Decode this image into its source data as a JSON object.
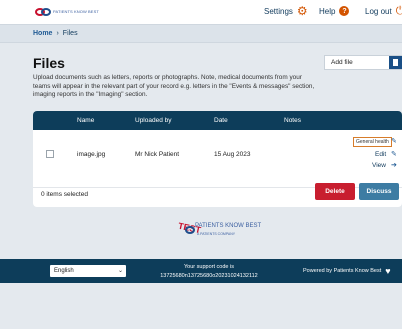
{
  "header": {
    "logo_text": "PATIENTS KNOW BEST",
    "settings_label": "Settings",
    "help_label": "Help",
    "logout_label": "Log out",
    "icons": {
      "settings": "gear-icon",
      "help": "question-circle-icon",
      "logout": "power-icon"
    },
    "accent": "#d35400"
  },
  "breadcrumb": {
    "home": "Home",
    "current": "Files"
  },
  "main": {
    "title": "Files",
    "description": "Upload documents such as letters, reports or photographs. Note, medical documents from your teams will appear in the relevant part of your record e.g. letters in the \"Events & messages\" section, imaging reports in the \"Imaging\" section.",
    "add_file_label": "Add file"
  },
  "table": {
    "columns": [
      "Name",
      "Uploaded by",
      "Date",
      "Notes"
    ],
    "rows": [
      {
        "name": "image.jpg",
        "uploaded_by": "Mr Nick Patient",
        "date": "15 Aug 2023",
        "notes": "",
        "tag": "General health",
        "edit_label": "Edit",
        "view_label": "View"
      }
    ],
    "selected_count": "0 items selected",
    "delete_label": "Delete",
    "discuss_label": "Discuss",
    "colors": {
      "header": "#0d3d5a",
      "delete": "#c81e2f",
      "discuss": "#3d7ca3"
    }
  },
  "brand": {
    "testing": "TEST",
    "name": "PATIENTS KNOW BEST",
    "sub": "A PATIENTS COMPANY"
  },
  "footer": {
    "language": "English",
    "support_label": "Your support code is",
    "support_code": "13725680n13725680o20231024132112",
    "powered_by": "Powered by Patients Know Best"
  }
}
